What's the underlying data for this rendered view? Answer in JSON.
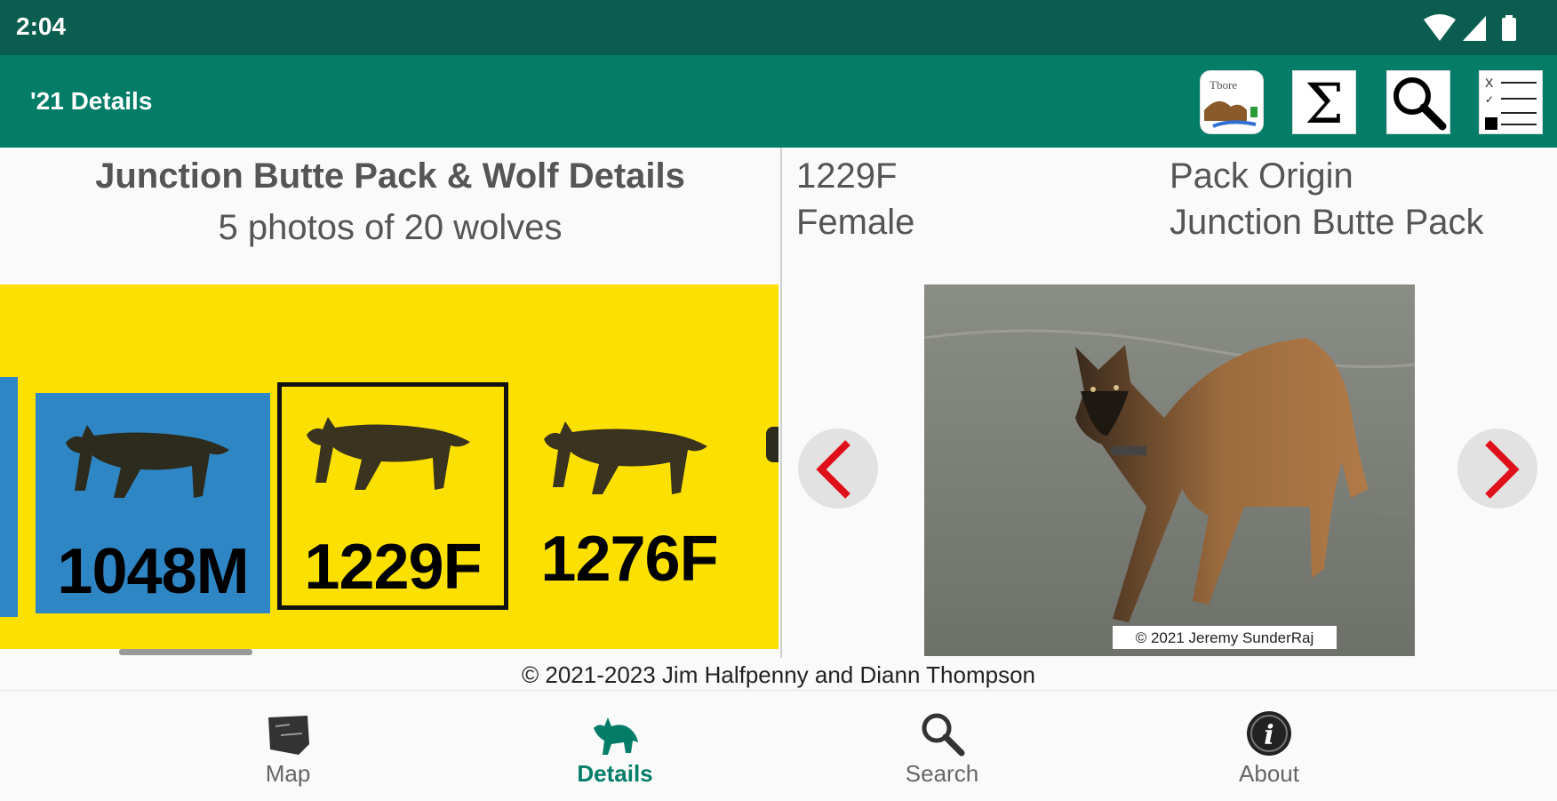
{
  "status_bar": {
    "time": "2:04",
    "icons": [
      "wifi-icon",
      "cell-signal-icon",
      "battery-icon"
    ]
  },
  "app_bar": {
    "title": "'21 Details",
    "actions": [
      {
        "name": "map-legend-button",
        "icon": "map-legend-icon"
      },
      {
        "name": "summary-button",
        "icon": "sigma-icon",
        "glyph": "Σ"
      },
      {
        "name": "search-button",
        "icon": "magnifier-icon"
      },
      {
        "name": "checklist-button",
        "icon": "checklist-icon"
      }
    ]
  },
  "left_panel": {
    "title": "Junction Butte Pack & Wolf Details",
    "subtitle": "5 photos of 20 wolves",
    "tiles": [
      {
        "label": "1048M",
        "background": "#2f86c4",
        "selected": false
      },
      {
        "label": "1229F",
        "background": "#fce000",
        "selected": true
      },
      {
        "label": "1276F",
        "background": "#fce000",
        "selected": false
      }
    ]
  },
  "right_panel": {
    "wolf_id": "1229F",
    "sex": "Female",
    "origin_label": "Pack Origin",
    "origin_value": "Junction Butte Pack",
    "photo_credit": "© 2021 Jeremy SunderRaj"
  },
  "copyright": "© 2021-2023 Jim Halfpenny and Diann Thompson",
  "bottom_nav": {
    "items": [
      {
        "label": "Map",
        "icon": "map-icon",
        "active": false
      },
      {
        "label": "Details",
        "icon": "wolf-icon",
        "active": true
      },
      {
        "label": "Search",
        "icon": "search-icon",
        "active": false
      },
      {
        "label": "About",
        "icon": "info-icon",
        "active": false
      }
    ]
  },
  "colors": {
    "status_bar": "#0b5e4f",
    "app_bar": "#037d68",
    "strip_yellow": "#fce000",
    "tile_blue": "#2f86c4",
    "arrow_red": "#e0101a"
  }
}
